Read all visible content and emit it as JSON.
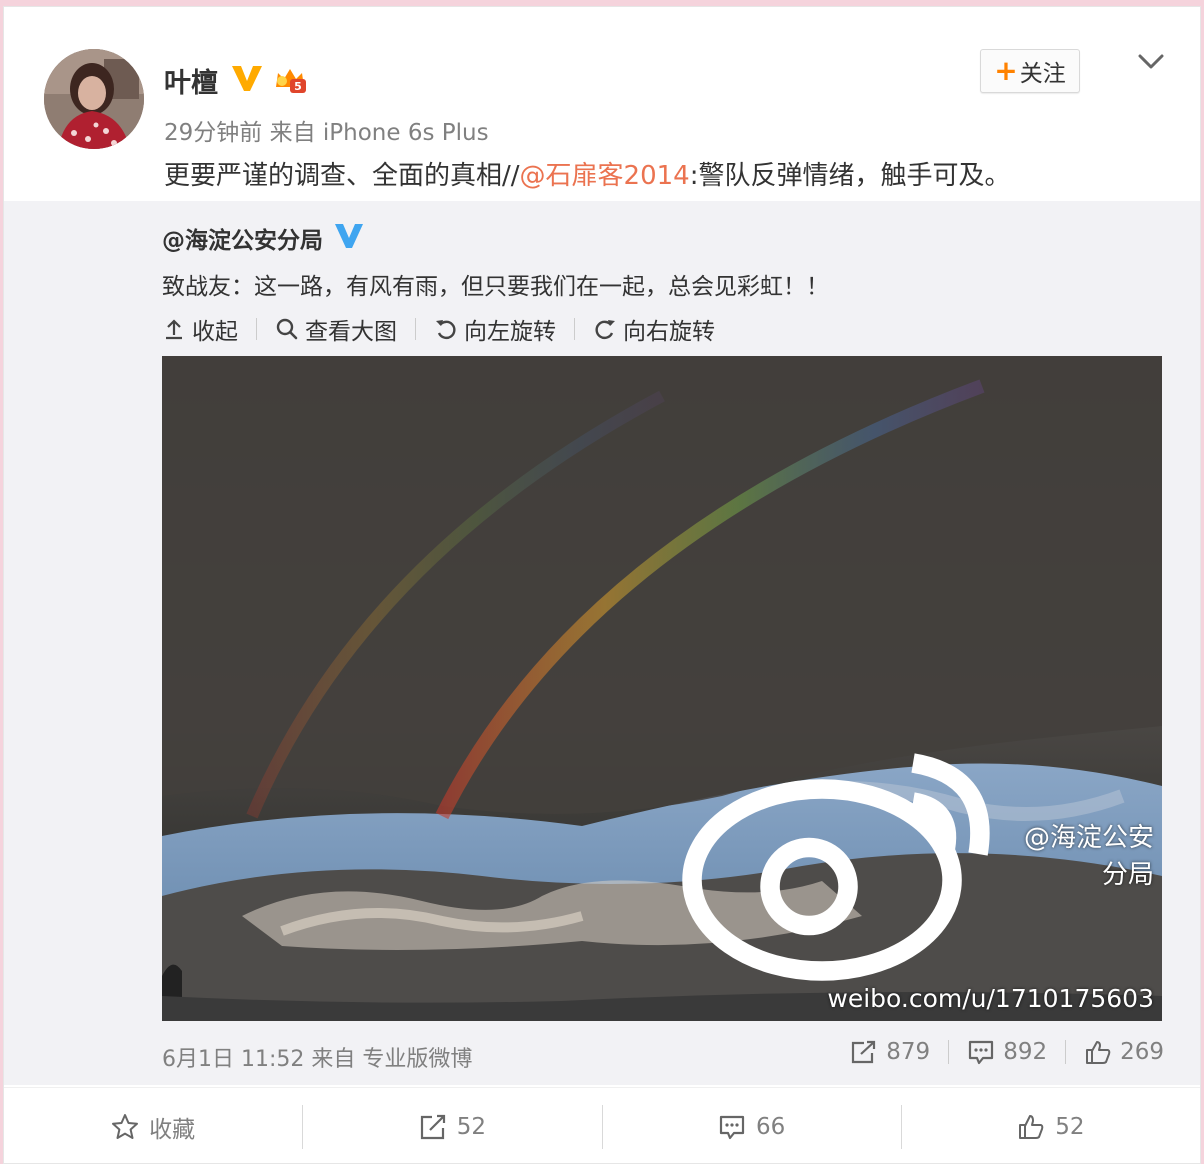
{
  "post": {
    "username": "叶檀",
    "meta": "29分钟前 来自 iPhone 6s Plus",
    "follow_label": "关注",
    "text_before": "更要严谨的调查、全面的真相//",
    "mention": "@石扉客2014",
    "text_after": ":警队反弹情绪，触手可及。"
  },
  "repost": {
    "author": "@海淀公安分局",
    "text": "致战友：这一路，有风有雨，但只要我们在一起，总会见彩虹！！",
    "tools": [
      {
        "label": "收起",
        "icon": "collapse-icon"
      },
      {
        "label": "查看大图",
        "icon": "magnifier-icon"
      },
      {
        "label": "向左旋转",
        "icon": "rotate-left-icon"
      },
      {
        "label": "向右旋转",
        "icon": "rotate-right-icon"
      }
    ],
    "watermark_name": "@海淀公安分局",
    "watermark_url": "weibo.com/u/1710175603",
    "footer": "6月1日 11:52 来自 专业版微博",
    "stats": {
      "reposts": "879",
      "comments": "892",
      "likes": "269"
    }
  },
  "actions": {
    "favorite": "收藏",
    "repost": "52",
    "comment": "66",
    "like": "52"
  },
  "colors": {
    "mention": "#eb7350",
    "follow_plus": "#ff8200",
    "background": "#f5d3dc",
    "repost_bg": "#f2f2f5"
  }
}
